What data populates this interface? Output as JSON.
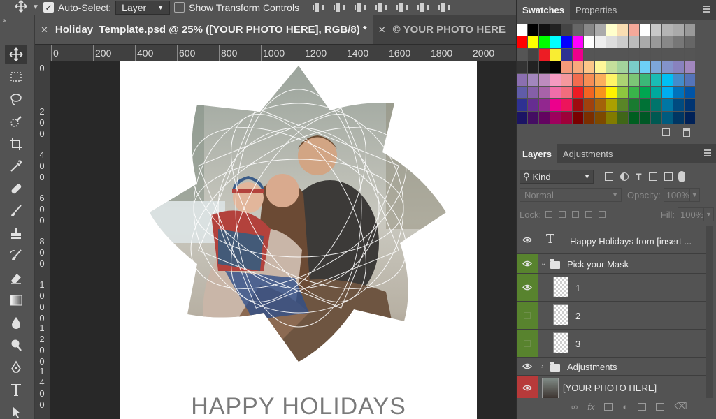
{
  "options_bar": {
    "auto_select_label": "Auto-Select:",
    "auto_select_value": "Layer",
    "show_transform_label": "Show Transform Controls",
    "auto_select_checked": true,
    "show_transform_checked": false
  },
  "document_tabs": [
    {
      "label": "Holiday_Template.psd @ 25% ([YOUR PHOTO HERE], RGB/8) *",
      "active": true
    },
    {
      "label": "© YOUR PHOTO HERE",
      "active": false
    }
  ],
  "ruler": {
    "top_ticks": [
      "0",
      "200",
      "400",
      "600",
      "800",
      "1000",
      "1200",
      "1400",
      "1600",
      "1800",
      "2000"
    ],
    "left_ticks": [
      "0",
      "200",
      "400",
      "600",
      "800",
      "1000",
      "1200",
      "1400"
    ]
  },
  "canvas": {
    "headline": "HAPPY HOLIDAYS",
    "background": "#ffffff",
    "headline_color": "#7a7a7a"
  },
  "swatches_panel": {
    "tabs": [
      "Swatches",
      "Properties"
    ],
    "rows": [
      [
        "#ffffff",
        "#000000",
        "#111111",
        "#222222",
        "#444444",
        "#666666",
        "#888888",
        "#aaaaaa",
        "#ffffcc",
        "#f9ddb2",
        "#f4a99a",
        "#ffffff",
        "#c8c8c8",
        "#b4b4b4",
        "#aaaaaa",
        "#999999"
      ],
      [
        "#ff0000",
        "#ffff00",
        "#00ff00",
        "#00ffff",
        "#0000ff",
        "#ff00ff",
        "#ffffff",
        "#eeeeee",
        "#dddddd",
        "#cccccc",
        "#bbbbbb",
        "#aaaaaa",
        "#999999",
        "#888888",
        "#777777",
        "#666666"
      ],
      [
        "#555555",
        "#444444",
        "#ed1c24",
        "#f9ed32",
        "#2e3192",
        "#ec008c",
        "#555555",
        "#555555",
        "#555555",
        "#555555",
        "#555555",
        "#555555",
        "#555555",
        "#555555",
        "#555555",
        "#555555"
      ],
      [
        "#333333",
        "#222222",
        "#111111",
        "#000000",
        "#f49a7a",
        "#f8a97c",
        "#fdc689",
        "#fff799",
        "#c4df9b",
        "#a3d39c",
        "#7accc8",
        "#6dcff6",
        "#7da7d9",
        "#8393ca",
        "#8882be",
        "#a187be"
      ],
      [
        "#8b6fb0",
        "#a286bd",
        "#bd8cbf",
        "#f49ac1",
        "#f5989d",
        "#f26c4f",
        "#f68e55",
        "#fbaf5c",
        "#fff467",
        "#acd372",
        "#7cc576",
        "#3bb878",
        "#1abbb4",
        "#00bff3",
        "#438ccb",
        "#5574b9"
      ],
      [
        "#605ca8",
        "#855fa8",
        "#a763a8",
        "#f06ea9",
        "#f26d7d",
        "#ed1c24",
        "#f26522",
        "#f7941d",
        "#fff200",
        "#8dc63f",
        "#39b54a",
        "#00a651",
        "#00a99d",
        "#00aeef",
        "#0072bc",
        "#0054a6"
      ],
      [
        "#2e3192",
        "#662d91",
        "#92278f",
        "#ec008c",
        "#ed145b",
        "#9e0b0f",
        "#a0410d",
        "#a36209",
        "#aba000",
        "#598527",
        "#197b30",
        "#007236",
        "#00746b",
        "#0076a3",
        "#004b80",
        "#003471"
      ],
      [
        "#1b1464",
        "#440e62",
        "#630460",
        "#9e005d",
        "#9e0039",
        "#790000",
        "#7b2e00",
        "#7d4900",
        "#827b00",
        "#406618",
        "#005e20",
        "#005826",
        "#005952",
        "#005b7f",
        "#003663",
        "#002157"
      ]
    ]
  },
  "layers_panel": {
    "tabs": [
      "Layers",
      "Adjustments"
    ],
    "filter_kind": "Kind",
    "blend_mode": "Normal",
    "opacity_label": "Opacity:",
    "opacity_value": "100%",
    "lock_label": "Lock:",
    "fill_label": "Fill:",
    "fill_value": "100%",
    "layers": [
      {
        "name": "Happy Holidays from [insert ...",
        "type": "text",
        "visible": true
      },
      {
        "name": "Pick your Mask",
        "type": "group-open",
        "visible": true
      },
      {
        "name": "1",
        "type": "mask",
        "visible": true
      },
      {
        "name": "2",
        "type": "mask",
        "visible": false
      },
      {
        "name": "3",
        "type": "mask",
        "visible": false
      },
      {
        "name": "Adjustments",
        "type": "group-closed",
        "visible": true
      },
      {
        "name": "[YOUR PHOTO HERE]",
        "type": "photo",
        "visible": true
      }
    ],
    "footer_icons": [
      "link-icon",
      "fx-icon",
      "mask-icon",
      "adjustment-icon",
      "group-icon",
      "new-layer-icon",
      "trash-icon"
    ]
  },
  "colors": {
    "ui_dark": "#535353",
    "tab_bar": "#424242",
    "green_tag": "#58832e",
    "red_tag": "#b73a3a"
  }
}
